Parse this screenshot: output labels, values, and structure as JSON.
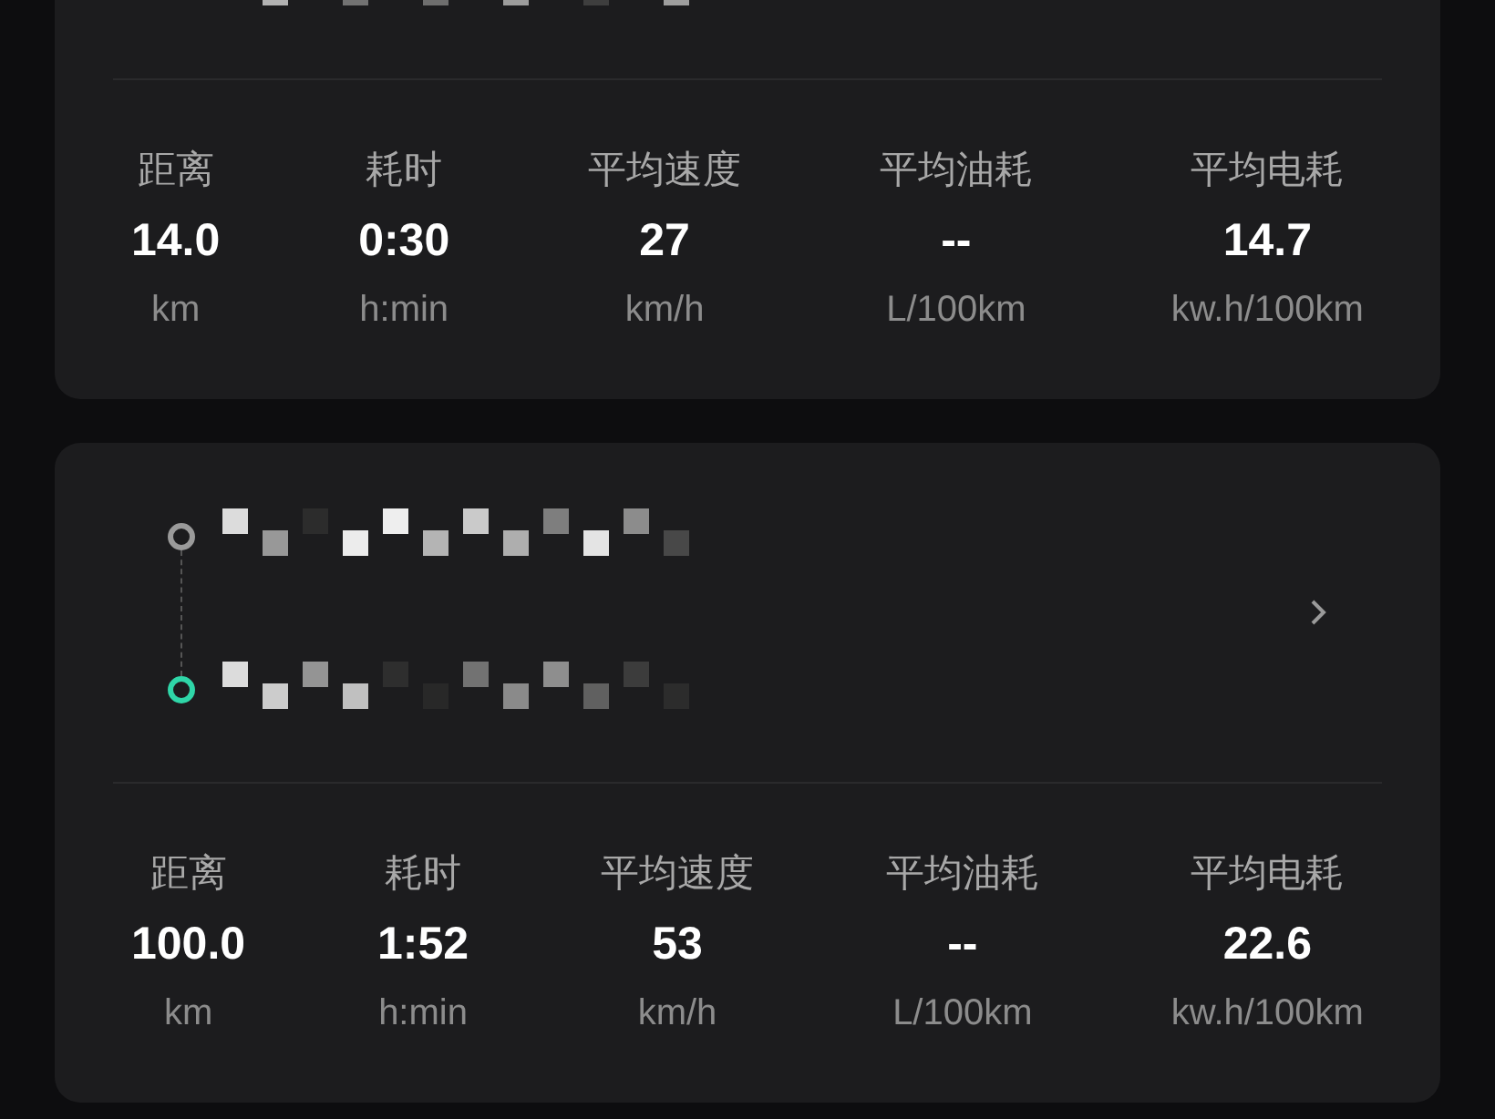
{
  "trips": [
    {
      "stats": [
        {
          "label": "距离",
          "value": "14.0",
          "unit": "km"
        },
        {
          "label": "耗时",
          "value": "0:30",
          "unit": "h:min"
        },
        {
          "label": "平均速度",
          "value": "27",
          "unit": "km/h"
        },
        {
          "label": "平均油耗",
          "value": "--",
          "unit": "L/100km"
        },
        {
          "label": "平均电耗",
          "value": "14.7",
          "unit": "kw.h/100km"
        }
      ]
    },
    {
      "stats": [
        {
          "label": "距离",
          "value": "100.0",
          "unit": "km"
        },
        {
          "label": "耗时",
          "value": "1:52",
          "unit": "h:min"
        },
        {
          "label": "平均速度",
          "value": "53",
          "unit": "km/h"
        },
        {
          "label": "平均油耗",
          "value": "--",
          "unit": "L/100km"
        },
        {
          "label": "平均电耗",
          "value": "22.6",
          "unit": "kw.h/100km"
        }
      ]
    }
  ]
}
